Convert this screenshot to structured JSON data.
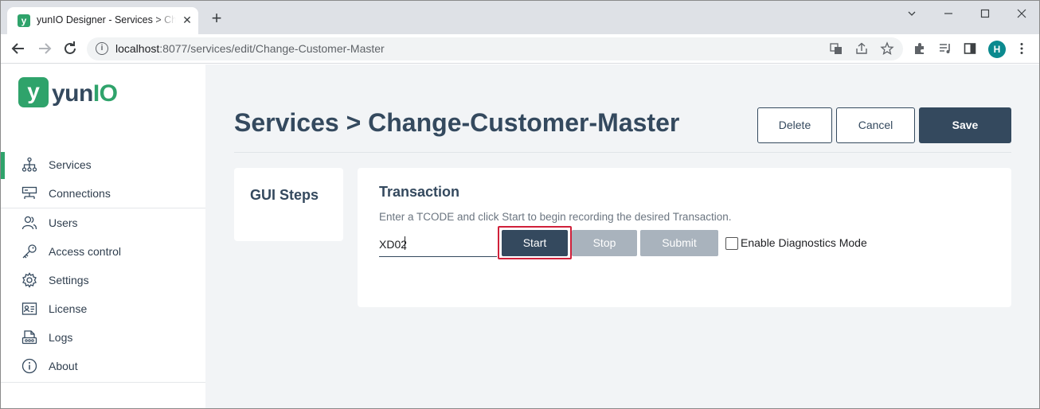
{
  "browser": {
    "tab_title": "yunIO Designer - Services > Change-Customer-Master",
    "tab_favicon_letter": "y",
    "new_tab_symbol": "+",
    "close_symbol": "✕",
    "url_host": "localhost",
    "url_path": ":8077/services/edit/Change-Customer-Master",
    "profile_initial": "H"
  },
  "app": {
    "logo_mark": "y",
    "logo_text_1": "yun",
    "logo_text_2": "IO",
    "accent": "#2fa36b",
    "brand_dark": "#34495e"
  },
  "sidebar": {
    "items": [
      {
        "label": "Services",
        "icon": "sitemap-icon",
        "active": true
      },
      {
        "label": "Connections",
        "icon": "connection-icon"
      },
      {
        "label": "Users",
        "icon": "users-icon"
      },
      {
        "label": "Access control",
        "icon": "key-icon"
      },
      {
        "label": "Settings",
        "icon": "gear-icon"
      },
      {
        "label": "License",
        "icon": "id-card-icon"
      },
      {
        "label": "Logs",
        "icon": "logs-icon"
      },
      {
        "label": "About",
        "icon": "info-icon"
      }
    ]
  },
  "header": {
    "title": "Services > Change-Customer-Master",
    "delete_label": "Delete",
    "cancel_label": "Cancel",
    "save_label": "Save"
  },
  "gui_steps": {
    "heading": "GUI Steps"
  },
  "transaction": {
    "heading": "Transaction",
    "help_text": "Enter a TCODE and click Start to begin recording the desired Transaction.",
    "tcode_value": "XD02",
    "start_label": "Start",
    "stop_label": "Stop",
    "submit_label": "Submit",
    "diagnostics_label": "Enable Diagnostics Mode",
    "diagnostics_checked": false
  }
}
